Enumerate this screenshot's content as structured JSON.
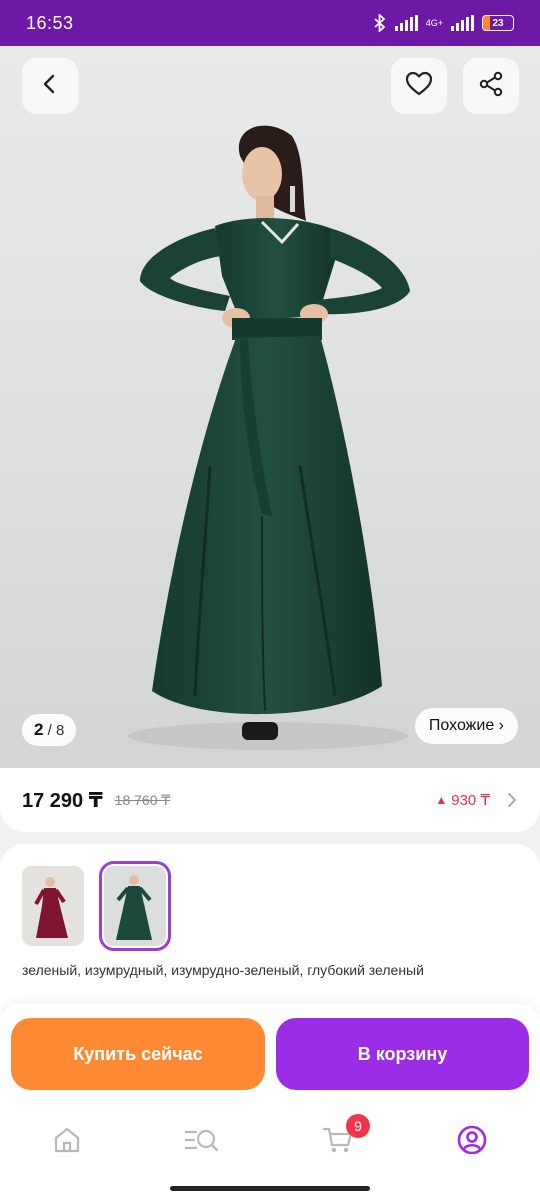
{
  "status_bar": {
    "time": "16:53",
    "network": "4G+",
    "battery": "23",
    "battery_level": 0.23
  },
  "gallery": {
    "current": "2",
    "total": "8",
    "similar_label": "Похожие ›"
  },
  "price": {
    "current": "17 290 ₸",
    "old": "18 760 ₸",
    "difference": "930 ₸"
  },
  "variants": {
    "thumbnails": [
      {
        "color": "burgundy",
        "selected": false
      },
      {
        "color": "emerald",
        "selected": true
      }
    ],
    "description": "зеленый, изумрудный, изумрудно-зеленый, глубокий зеленый"
  },
  "actions": {
    "buy_now": "Купить сейчас",
    "add_to_cart": "В корзину"
  },
  "nav": {
    "cart_count": "9",
    "items": [
      "home-icon",
      "catalog-icon",
      "cart-icon",
      "profile-icon"
    ]
  },
  "colors": {
    "status_bar": "#6c1aa6",
    "buy_button": "#ff8a33",
    "cart_button": "#9b2de6",
    "accent": "#9b2de6",
    "price_diff": "#e0334a",
    "dress_green": "#1c4a3a",
    "dress_burgundy": "#7d1430"
  }
}
